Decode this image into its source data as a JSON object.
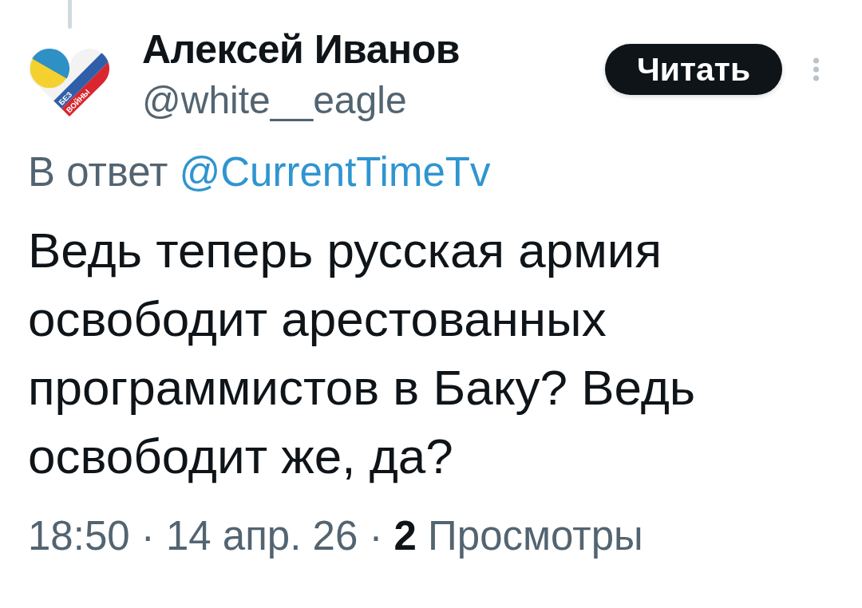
{
  "author": {
    "name": "Алексей Иванов",
    "handle": "@white__eagle",
    "avatar": {
      "text_top": "БЕЗ",
      "text_bottom": "ВОЙНЫ"
    }
  },
  "follow_button": {
    "label": "Читать"
  },
  "reply_to": {
    "prefix": "В ответ",
    "handle": "@CurrentTimeTv"
  },
  "body": "Ведь теперь русская армия освободит арестованных программистов в Баку? Ведь освободит же, да?",
  "meta": "18:50 · 14 апр. 26 · **2** Просмотры"
}
